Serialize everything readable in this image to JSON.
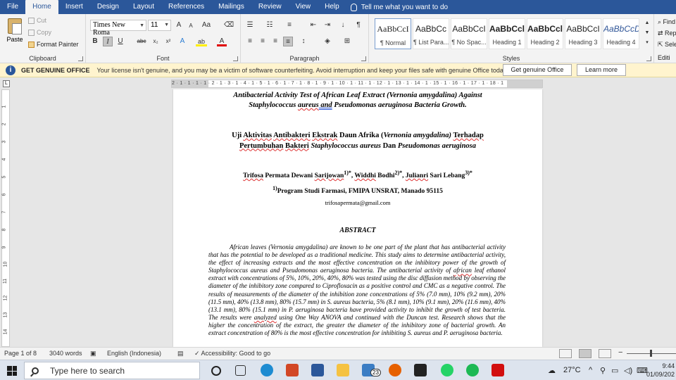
{
  "menu": {
    "items": [
      "File",
      "Home",
      "Insert",
      "Design",
      "Layout",
      "References",
      "Mailings",
      "Review",
      "View",
      "Help"
    ],
    "active": "Home",
    "tell_me": "Tell me what you want to do"
  },
  "ribbon": {
    "clipboard": {
      "label": "Clipboard",
      "paste": "Paste",
      "cut": "Cut",
      "copy": "Copy",
      "format_painter": "Format Painter"
    },
    "font": {
      "label": "Font",
      "font_name": "Times New Roma",
      "font_size": "11",
      "grow": "A",
      "shrink": "A",
      "change_case": "Aa",
      "bold": "B",
      "italic": "I",
      "underline": "U",
      "strikethrough": "abc",
      "subscript": "x₂",
      "superscript": "x²",
      "text_effects": "A",
      "highlight": "ab",
      "font_color": "A"
    },
    "paragraph": {
      "label": "Paragraph"
    },
    "styles": {
      "label": "Styles",
      "items": [
        {
          "sample": "AaBbCcI",
          "name": "¶ Normal"
        },
        {
          "sample": "AaBbCc",
          "name": "¶ List Para..."
        },
        {
          "sample": "AaBbCcI",
          "name": "¶ No Spac..."
        },
        {
          "sample": "AaBbCcl",
          "name": "Heading 1"
        },
        {
          "sample": "AaBbCcl",
          "name": "Heading 2"
        },
        {
          "sample": "AaBbCcI",
          "name": "Heading 3"
        },
        {
          "sample": "AaBbCcD",
          "name": "Heading 4"
        }
      ]
    },
    "editing": {
      "label": "Editi",
      "find": "Find",
      "replace": "Rep",
      "select": "Sele"
    }
  },
  "message_bar": {
    "title": "GET GENUINE OFFICE",
    "text": "Your license isn't genuine, and you may be a victim of software counterfeiting. Avoid interruption and keep your files safe with genuine Office today.",
    "primary_button": "Get genuine Office",
    "secondary_button": "Learn more"
  },
  "ruler": {
    "scale": "2 · 1 · 1 · 1 · 1 · 2 · 1 · 3 · 1 · 4 · 1 · 5 · 1 · 6 · 1 · 7 · 1 · 8 · 1 · 9 · 1 · 10 · 1 · 11 · 1 · 12 · 1 · 13 · 1 · 14 · 1 · 15 · 1 · 16 · 1 · 17 · 1 · 18 · 1",
    "vertical": [
      "1",
      "2",
      "3",
      "4",
      "5",
      "6",
      "7",
      "8",
      "9",
      "10",
      "11",
      "12",
      "13",
      "14",
      "15"
    ]
  },
  "document": {
    "title_en_1": "Antibacterial Activity Test of African Leaf Extract (Vernonia amygdalina) Against",
    "title_en_2a": "Staphylococcus ",
    "title_en_2b": "aureus",
    "title_en_2c": "  and",
    "title_en_2d": " Pseudomonas aeruginosa Bacteria Growth.",
    "title_id_1a": "Uji ",
    "title_id_1b": "Aktivitas",
    "title_id_1c": " ",
    "title_id_1d": "Antibakteri",
    "title_id_1e": " ",
    "title_id_1f": "Ekstrak",
    "title_id_1g": " Daun Afrika (",
    "title_id_1h": "Vernonia amygdalina)",
    "title_id_1i": " ",
    "title_id_1j": "Terhadap",
    "title_id_2a": "Pertumbuhan",
    "title_id_2b": " ",
    "title_id_2c": "Bakteri",
    "title_id_2d": " Staphylococcus aureus",
    "title_id_2e": " Dan ",
    "title_id_2f": "Pseudomonas aeruginosa",
    "authors_a": "Trifosa",
    "authors_b": " Permata Dewani ",
    "authors_c": "Sarijowan",
    "authors_d": "1)*",
    "authors_e": ", ",
    "authors_f": "Widdhi",
    "authors_g": " Bodhi",
    "authors_h": "2)*",
    "authors_i": ", ",
    "authors_j": "Julianri",
    "authors_k": " Sari Lebang",
    "authors_l": "3)*",
    "affil_sup": "1)",
    "affil": "Program Studi Farmasi, FMIPA UNSRAT, Manado 95115",
    "email": "trifosapermata@gmail.com",
    "abstract_title": "ABSTRACT",
    "abstract_1": "African leaves (Vernonia amygdalina) are known to be one part of the plant that has antibacterial activity that has the potential to be developed as a traditional medicine. This study aims to determine antibacterial activity, the effect of increasing extracts and the most effective concentration on the inhibitory power of the growth of Staphylococcus aureus and Pseudomonas aeruginosa bacteria. The antibacterial activity of ",
    "abstract_2": "african",
    "abstract_3": " leaf ethanol extract with concentrations of 5%, 10%, 20%, 40%, 80% was tested using the disc diffusion method by observing the diameter of the inhibitory zone compared to Ciprofloxacin as a positive control and CMC as a negative control. The results of measurements of the diameter of the inhibition zone concentrations of 5% (7.0 mm), 10% (9.2 mm), 20% (11.5 mm), 40% (13.8 mm), 80% (15.7 mm) in S. aureus bacteria, 5% (8.1 mm), 10% (9.1 mm), 20% (11.6 mm), 40% (13.1 mm), 80% (15.1 mm) in P. aeruginosa bacteria have provided activity to inhibit the growth of test bacteria. The results were ",
    "abstract_4": "analyzed",
    "abstract_5": " using One Way ANOVA and continued with the Duncan test. Research shows that the higher the concentration of the extract, the greater the diameter of the inhibitory zone of bacterial growth. An extract concentration of 80% is the most effective concentration for inhibiting S. aureus and P. aeruginosa bacteria."
  },
  "status": {
    "page": "Page 1 of 8",
    "words": "3040 words",
    "language": "English (Indonesia)",
    "accessibility": "Accessibility: Good to go"
  },
  "taskbar": {
    "search_placeholder": "Type here to search",
    "mail_badge": "23",
    "temperature": "27°C",
    "time": "9:44",
    "date": "01/09/202"
  }
}
